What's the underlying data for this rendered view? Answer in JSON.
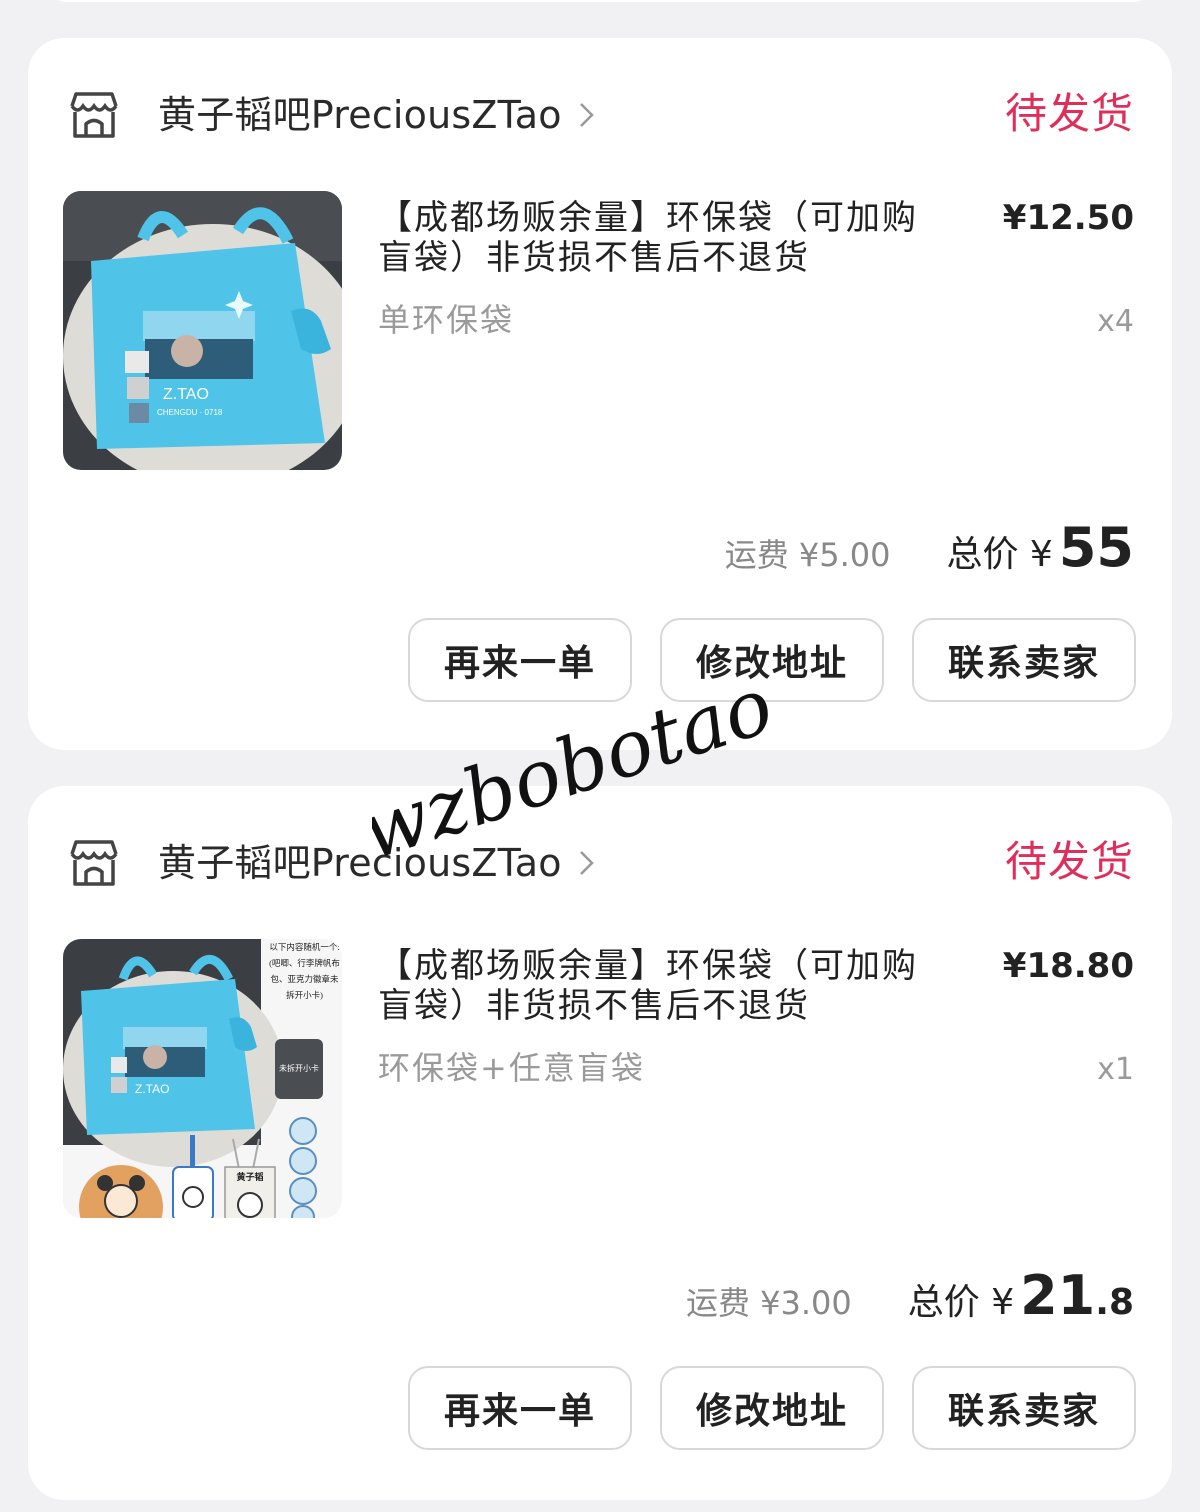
{
  "colors": {
    "accent": "#e02e5a",
    "card": "#ffffff",
    "background": "#f1f1f3",
    "muted": "#9a9a9a",
    "bag": "#4fc3e8"
  },
  "orders": [
    {
      "shop_name": "黄子韬吧PreciousZTao",
      "status": "待发货",
      "item_title": "【成都场贩余量】环保袋（可加购盲袋）非货损不售后不退货",
      "price": "¥12.50",
      "variant": "单环保袋",
      "quantity": "x4",
      "shipping": "运费 ¥5.00",
      "total_label": "总价 ¥",
      "total_main": "55",
      "total_decimal": "",
      "thumb_text": {
        "brand": "Z.TAO",
        "sub": "CHENGDU · 0718"
      },
      "buttons": [
        "再来一单",
        "修改地址",
        "联系卖家"
      ]
    },
    {
      "shop_name": "黄子韬吧PreciousZTao",
      "status": "待发货",
      "item_title": "【成都场贩余量】环保袋（可加购盲袋）非货损不售后不退货",
      "price": "¥18.80",
      "variant": "环保袋+任意盲袋",
      "quantity": "x1",
      "shipping": "运费 ¥3.00",
      "total_label": "总价 ¥",
      "total_main": "21",
      "total_decimal": ".8",
      "thumb_text": {
        "brand": "Z.TAO",
        "side_note": "以下内容随机一个:(吧唧、行李牌帆布包、亚克力徽章未拆开小卡)",
        "card_label": "未拆开小卡",
        "tote_label": "黄子韬"
      },
      "buttons": [
        "再来一单",
        "修改地址",
        "联系卖家"
      ]
    }
  ],
  "watermark": "wzbobotao"
}
